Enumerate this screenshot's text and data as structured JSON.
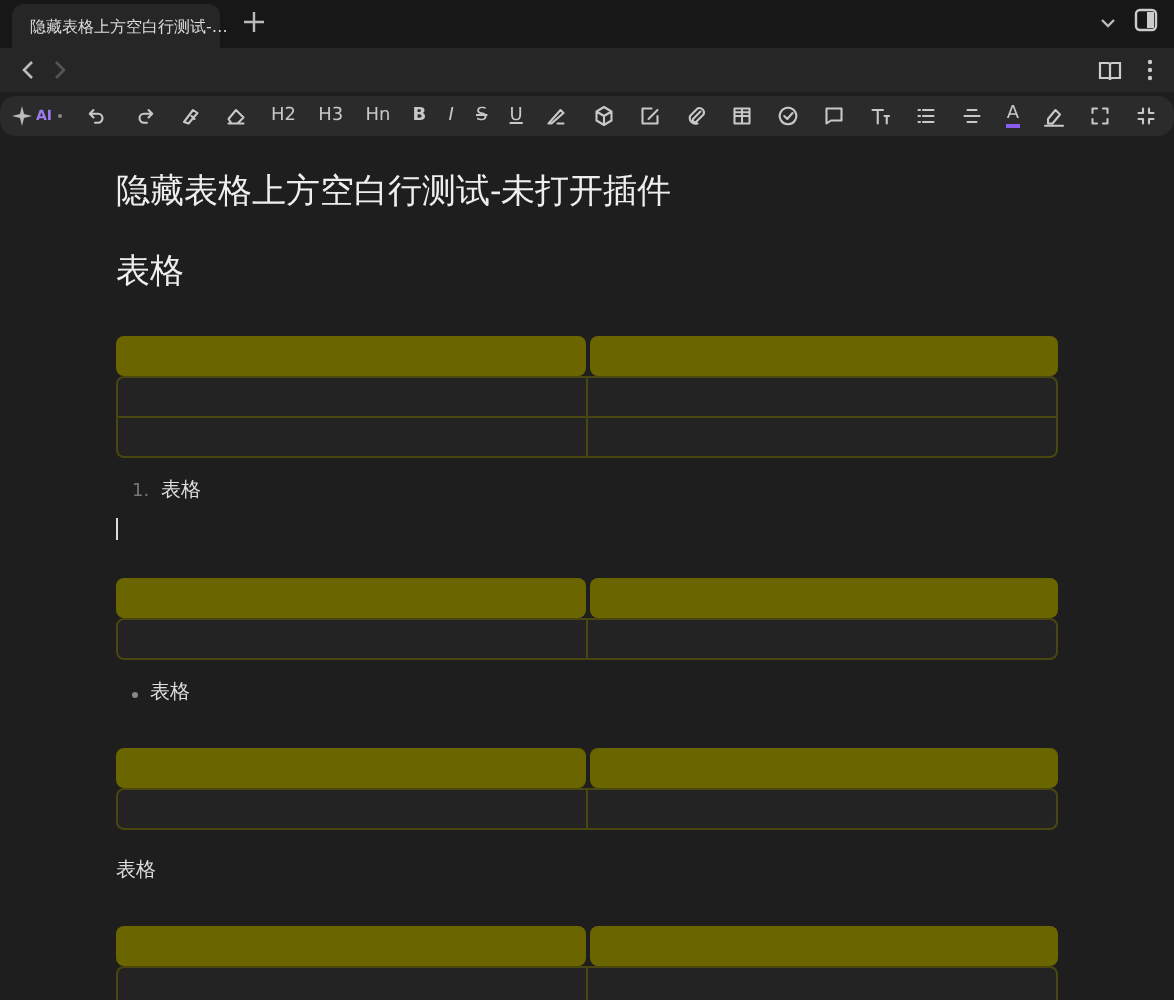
{
  "tabs": [
    {
      "title": "隐藏表格上方空白行测试-…",
      "selected": true
    }
  ],
  "toolbar": [
    {
      "kind": "ai",
      "label": "AI"
    },
    {
      "kind": "icon"
    },
    {
      "kind": "icon"
    },
    {
      "kind": "icon"
    },
    {
      "kind": "icon"
    },
    {
      "kind": "text",
      "label": "H2"
    },
    {
      "kind": "text",
      "label": "H3"
    },
    {
      "kind": "text",
      "label": "Hn"
    },
    {
      "kind": "text",
      "label": "B"
    },
    {
      "kind": "text",
      "label": "I"
    },
    {
      "kind": "text",
      "label": "S"
    },
    {
      "kind": "text",
      "label": "U"
    },
    {
      "kind": "icon"
    },
    {
      "kind": "icon"
    },
    {
      "kind": "icon"
    },
    {
      "kind": "icon"
    },
    {
      "kind": "icon"
    },
    {
      "kind": "icon"
    },
    {
      "kind": "icon"
    },
    {
      "kind": "icon"
    },
    {
      "kind": "icon"
    },
    {
      "kind": "icon"
    },
    {
      "kind": "color",
      "label": "A",
      "color": "#8a5cf0"
    },
    {
      "kind": "icon"
    },
    {
      "kind": "icon"
    },
    {
      "kind": "icon"
    }
  ],
  "document": {
    "title": "隐藏表格上方空白行测试-未打开插件",
    "blocks": [
      {
        "kind": "heading",
        "text": "表格"
      },
      {
        "kind": "table",
        "header": [
          {
            "kind": "empty"
          },
          {
            "kind": "empty"
          }
        ],
        "rows": [
          [
            {
              "kind": "empty"
            },
            {
              "kind": "empty"
            }
          ],
          [
            {
              "kind": "empty"
            },
            {
              "kind": "empty"
            }
          ]
        ]
      },
      {
        "kind": "ordered",
        "number": "1.",
        "text": "表格"
      },
      {
        "kind": "cursor"
      },
      {
        "kind": "table",
        "header": [
          {
            "kind": "empty"
          },
          {
            "kind": "empty"
          }
        ],
        "rows": [
          [
            {
              "kind": "empty"
            },
            {
              "kind": "empty"
            }
          ]
        ]
      },
      {
        "kind": "bullet",
        "text": "表格"
      },
      {
        "kind": "table",
        "header": [
          {
            "kind": "empty"
          },
          {
            "kind": "empty"
          }
        ],
        "rows": [
          [
            {
              "kind": "empty"
            },
            {
              "kind": "empty"
            }
          ]
        ]
      },
      {
        "kind": "paragraph",
        "text": "表格"
      },
      {
        "kind": "table",
        "header": [
          {
            "kind": "empty"
          },
          {
            "kind": "empty"
          }
        ],
        "rows": [
          [
            {
              "kind": "empty"
            },
            {
              "kind": "empty"
            }
          ]
        ]
      }
    ]
  }
}
